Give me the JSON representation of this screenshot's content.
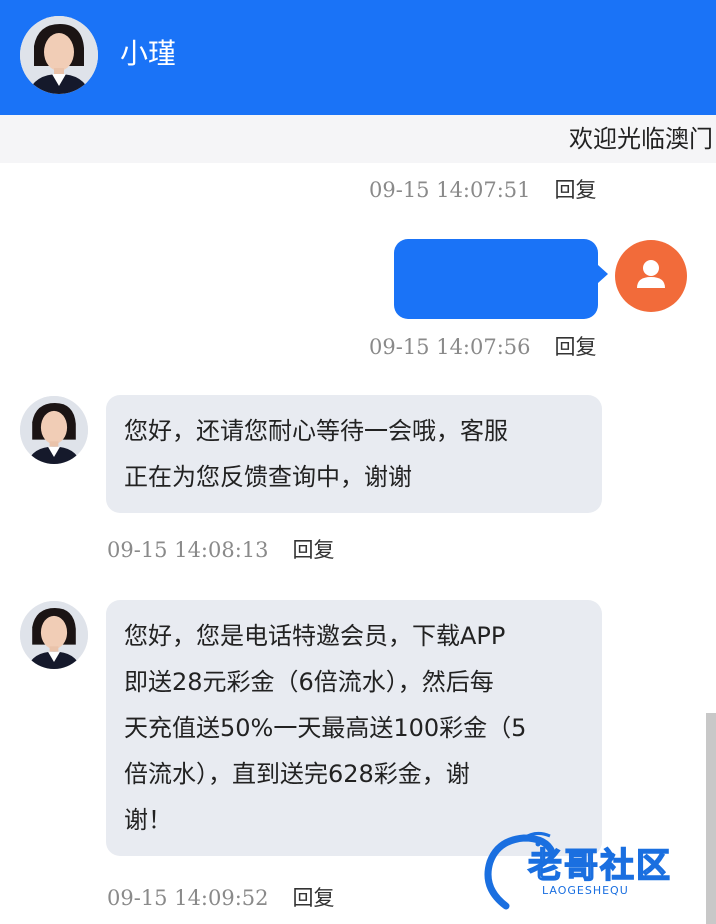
{
  "header": {
    "name": "小瑾",
    "avatar_icon": "agent-avatar-icon",
    "color": "#1a73f7"
  },
  "marquee": {
    "text": "欢迎光临澳门"
  },
  "messages": [
    {
      "role": "system",
      "time": "09-15 14:07:51",
      "reply": "回复"
    },
    {
      "role": "user",
      "text": "",
      "time": "09-15 14:07:56",
      "reply": "回复",
      "avatar_color": "#f26b3a"
    },
    {
      "role": "agent",
      "lines": [
        "您好，还请您耐心等待一会哦，客服",
        "正在为您反馈查询中，谢谢"
      ],
      "time": "09-15 14:08:13",
      "reply": "回复"
    },
    {
      "role": "agent",
      "lines": [
        "您好，您是电话特邀会员，下载APP",
        "即送28元彩金（6倍流水），然后每",
        "天充值送50%一天最高送100彩金（5",
        "倍流水），直到送完628彩金，谢",
        "谢！"
      ],
      "time": "09-15 14:09:52",
      "reply": "回复"
    }
  ],
  "watermark": {
    "title": "老哥社区",
    "subtitle": "LAOGESHEQU"
  }
}
